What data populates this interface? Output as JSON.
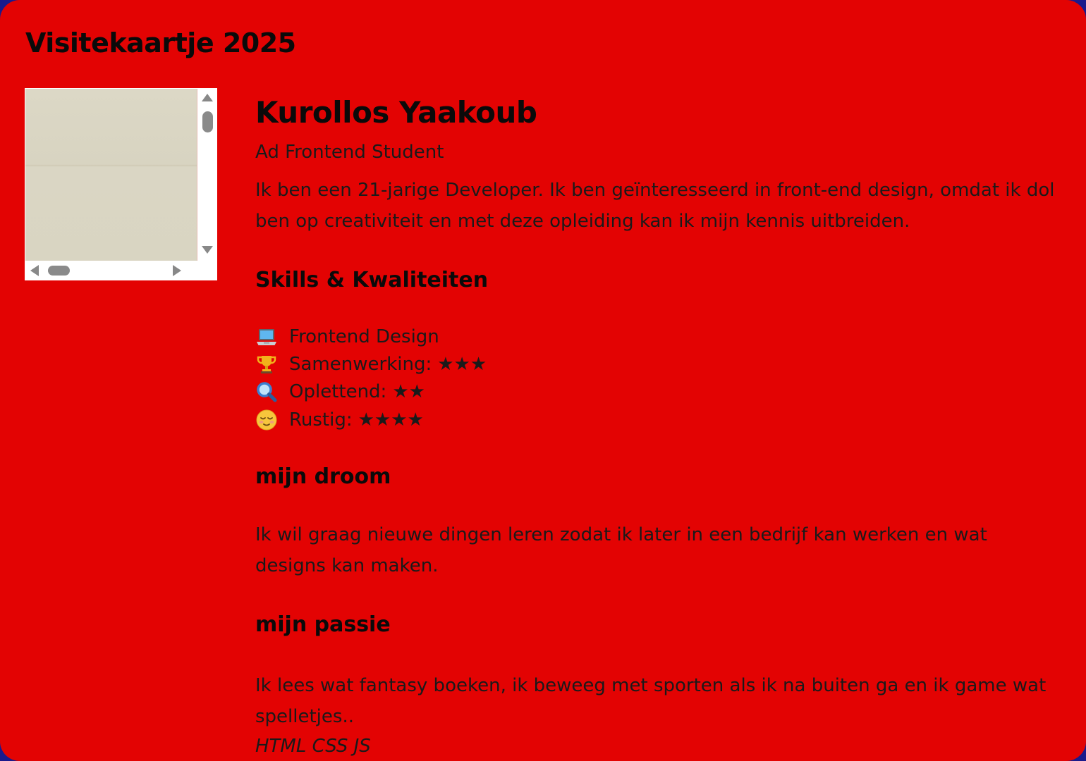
{
  "header": {
    "title": "Visitekaartje 2025"
  },
  "profile": {
    "name": "Kurollos Yaakoub",
    "role": "Ad Frontend Student",
    "intro": "Ik ben een 21-jarige Developer. Ik ben geïnteresseerd in front-end design, omdat ik dol ben op creativiteit en met deze opleiding kan ik mijn kennis uitbreiden."
  },
  "skills": {
    "heading": "Skills & Kwaliteiten",
    "items": [
      {
        "icon": "laptop-icon",
        "label": "Frontend Design",
        "stars": ""
      },
      {
        "icon": "trophy-icon",
        "label": "Samenwerking:",
        "stars": "★★★"
      },
      {
        "icon": "magnifier-icon",
        "label": "Oplettend:",
        "stars": "★★"
      },
      {
        "icon": "relieved-face-icon",
        "label": "Rustig:",
        "stars": "★★★★"
      }
    ]
  },
  "dream": {
    "heading": "mijn droom",
    "text": "Ik wil graag nieuwe dingen leren zodat ik later in een bedrijf kan werken en wat designs kan maken."
  },
  "passion": {
    "heading": "mijn passie",
    "text": "Ik lees wat fantasy boeken, ik beweeg met sporten als ik na buiten ga en ik game wat spelletjes.."
  },
  "footer": {
    "tech": "HTML CSS JS"
  },
  "colors": {
    "card_background": "#e30303",
    "page_background": "#1a1a8c",
    "text": "#111111"
  }
}
